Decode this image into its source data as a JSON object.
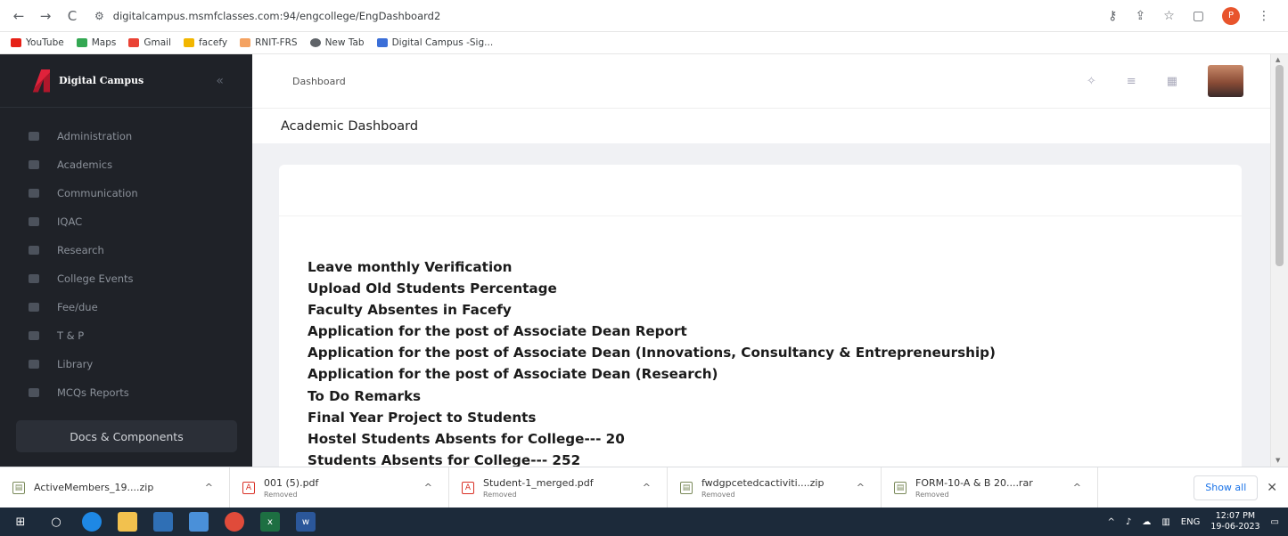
{
  "browser": {
    "url": "digitalcampus.msmfclasses.com:94/engcollege/EngDashboard2",
    "profile_initial": "P",
    "bookmarks": [
      "YouTube",
      "Maps",
      "Gmail",
      "facefy",
      "RNIT-FRS",
      "New Tab",
      "Digital Campus -Sig..."
    ]
  },
  "sidebar": {
    "brand": "Digital Campus",
    "items": [
      "Administration",
      "Academics",
      "Communication",
      "IQAC",
      "Research",
      "College Events",
      "Fee/due",
      "T & P",
      "Library",
      "MCQs Reports"
    ],
    "docs_button": "Docs & Components"
  },
  "header": {
    "breadcrumb": "Dashboard",
    "page_title": "Academic Dashboard"
  },
  "dashboard": {
    "links": [
      "Leave monthly Verification",
      "Upload Old Students Percentage",
      "Faculty Absentes in Facefy",
      "Application for the post of Associate Dean Report",
      "Application for the post of Associate Dean (Innovations, Consultancy & Entrepreneurship)",
      "Application for the post of Associate Dean (Research)",
      "To Do Remarks",
      "Final Year Project to Students",
      "Hostel Students Absents for College--- 20",
      "Students Absents for College--- 252"
    ]
  },
  "downloads": {
    "items": [
      {
        "name": "ActiveMembers_19....zip",
        "status": ""
      },
      {
        "name": "001 (5).pdf",
        "status": "Removed"
      },
      {
        "name": "Student-1_merged.pdf",
        "status": "Removed"
      },
      {
        "name": "fwdgpcetedcactiviti....zip",
        "status": "Removed"
      },
      {
        "name": "FORM-10-A & B 20....rar",
        "status": "Removed"
      }
    ],
    "show_all": "Show all"
  },
  "taskbar": {
    "language": "ENG",
    "time": "12:07 PM",
    "date": "19-06-2023"
  }
}
